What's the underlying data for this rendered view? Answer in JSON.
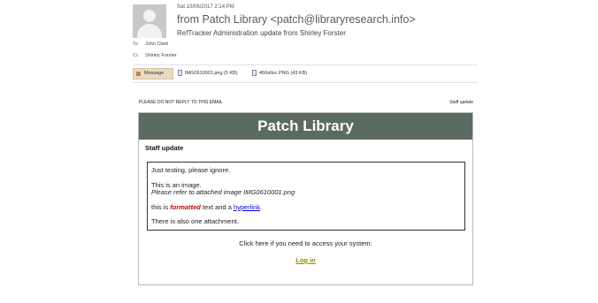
{
  "email": {
    "date": "Sat 10/06/2017 2:14 PM",
    "from": "from Patch Library <patch@libraryresearch.info>",
    "subject": "RefTracker Administration update from Shirley Forster",
    "to_label": "To",
    "to_value": "John Clark",
    "cc_label": "Cc",
    "cc_value": "Shirley Forster"
  },
  "attachments_bar": {
    "message_tab": "Message",
    "items": [
      {
        "label": "IMG0610001.png (5 KB)"
      },
      {
        "label": "450alloc.PNG (43 KB)"
      }
    ]
  },
  "body": {
    "no_reply": "PLEASE DO NOT REPLY TO THIS EMAIL",
    "staff_update_small": "Staff update",
    "banner_title": "Patch Library",
    "section_title": "Staff update",
    "line1": "Just testing, please ignore.",
    "line2": "This is an image.",
    "line3": "Please refer to attached image IMG0610001.png",
    "line4_prefix": "this is ",
    "line4_formatted": "formatted",
    "line4_middle": " text and a ",
    "line4_link": "hyperlink",
    "line4_suffix": ".",
    "line5": "There is also one attachment.",
    "click_text": "Click here if you need to access your system:",
    "login_link": "Log in"
  },
  "colors": {
    "banner_bg": "#5c6b61",
    "link": "#0000ee",
    "formatted": "#cc0000",
    "login": "#9a8700"
  }
}
